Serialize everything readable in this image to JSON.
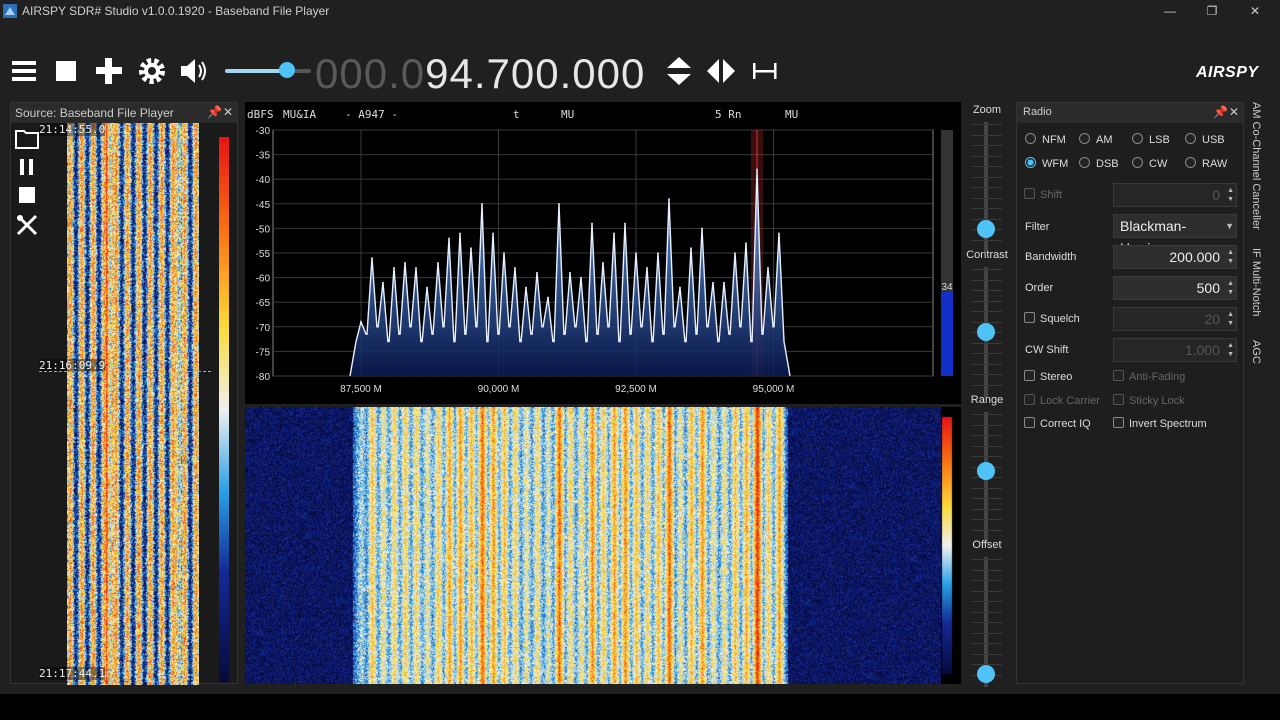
{
  "window": {
    "title": "AIRSPY SDR# Studio v1.0.0.1920 - Baseband File Player",
    "controls": [
      "minimize",
      "restore",
      "close"
    ]
  },
  "toolbar": {
    "buttons": [
      "menu-icon",
      "stop-icon",
      "add-icon",
      "settings-icon",
      "volume-icon"
    ],
    "volume_level": 0.72,
    "frequency_dim": "000.0",
    "frequency_bright": "94.700.000",
    "brand": "AIRSPY"
  },
  "source_panel": {
    "title": "Source: Baseband File Player",
    "timestamps": [
      "21:14:55.0",
      "21:16:09.9",
      "21:17:44.1"
    ]
  },
  "spectrum": {
    "header_labels": [
      "dBFS",
      "MU&IA",
      "- A947 -",
      "t",
      "MU",
      "5 Rn",
      "MU"
    ],
    "level_readout": "34"
  },
  "chart_data": {
    "type": "line",
    "title": "",
    "ylabel": "dBFS",
    "xlabel": "",
    "y_ticks": [
      "-30",
      "-35",
      "-40",
      "-45",
      "-50",
      "-55",
      "-60",
      "-65",
      "-70",
      "-75",
      "-80"
    ],
    "x_ticks": [
      "87,500 M",
      "90,000 M",
      "92,500 M",
      "95,000 M"
    ],
    "xlim": [
      85900,
      97900
    ],
    "ylim": [
      -80,
      -30
    ],
    "grid": true,
    "tuned_frequency": 94700,
    "series": [
      {
        "x": [
          87500,
          87700,
          87900,
          88100,
          88300,
          88500,
          88700,
          88900,
          89100,
          89300,
          89500,
          89700,
          89900,
          90100,
          90300,
          90500,
          90700,
          90900,
          91100,
          91300,
          91500,
          91700,
          91900,
          92100,
          92300,
          92500,
          92700,
          92900,
          93100,
          93300,
          93500,
          93700,
          93900,
          94100,
          94300,
          94500,
          94700,
          94900,
          95100
        ],
        "y": [
          -69,
          -56,
          -61,
          -58,
          -57,
          -58,
          -62,
          -57,
          -52,
          -51,
          -54,
          -45,
          -51,
          -55,
          -58,
          -62,
          -59,
          -64,
          -45,
          -59,
          -60,
          -49,
          -57,
          -51,
          -49,
          -55,
          -58,
          -55,
          -44,
          -62,
          -54,
          -50,
          -61,
          -61,
          -55,
          -53,
          -38,
          -58,
          -51
        ]
      }
    ]
  },
  "sliders": [
    {
      "label": "Zoom",
      "value": 0.18
    },
    {
      "label": "Contrast",
      "value": 0.5
    },
    {
      "label": "Range",
      "value": 0.55
    },
    {
      "label": "Offset",
      "value": 0.1
    }
  ],
  "radio": {
    "title": "Radio",
    "modes": [
      "NFM",
      "AM",
      "LSB",
      "USB",
      "WFM",
      "DSB",
      "CW",
      "RAW"
    ],
    "selected_mode": "WFM",
    "shift_label": "Shift",
    "shift_value": "0",
    "filter_label": "Filter",
    "filter_value": "Blackman-Harris",
    "bandwidth_label": "Bandwidth",
    "bandwidth_value": "200.000",
    "order_label": "Order",
    "order_value": "500",
    "squelch_label": "Squelch",
    "squelch_value": "20",
    "cwshift_label": "CW Shift",
    "cwshift_value": "1.000",
    "stereo_label": "Stereo",
    "antifading_label": "Anti-Fading",
    "lockcarrier_label": "Lock Carrier",
    "stickylock_label": "Sticky Lock",
    "correctiq_label": "Correct IQ",
    "invert_label": "Invert Spectrum"
  },
  "side_tabs": [
    "AM Co-Channel Canceller",
    "IF Multi-Notch",
    "AGC"
  ],
  "colors": {
    "accent": "#4fc3f7",
    "background": "#202020",
    "spectrum_line": "#e8f0ff",
    "spectrum_fill": "#1e5aa8"
  }
}
